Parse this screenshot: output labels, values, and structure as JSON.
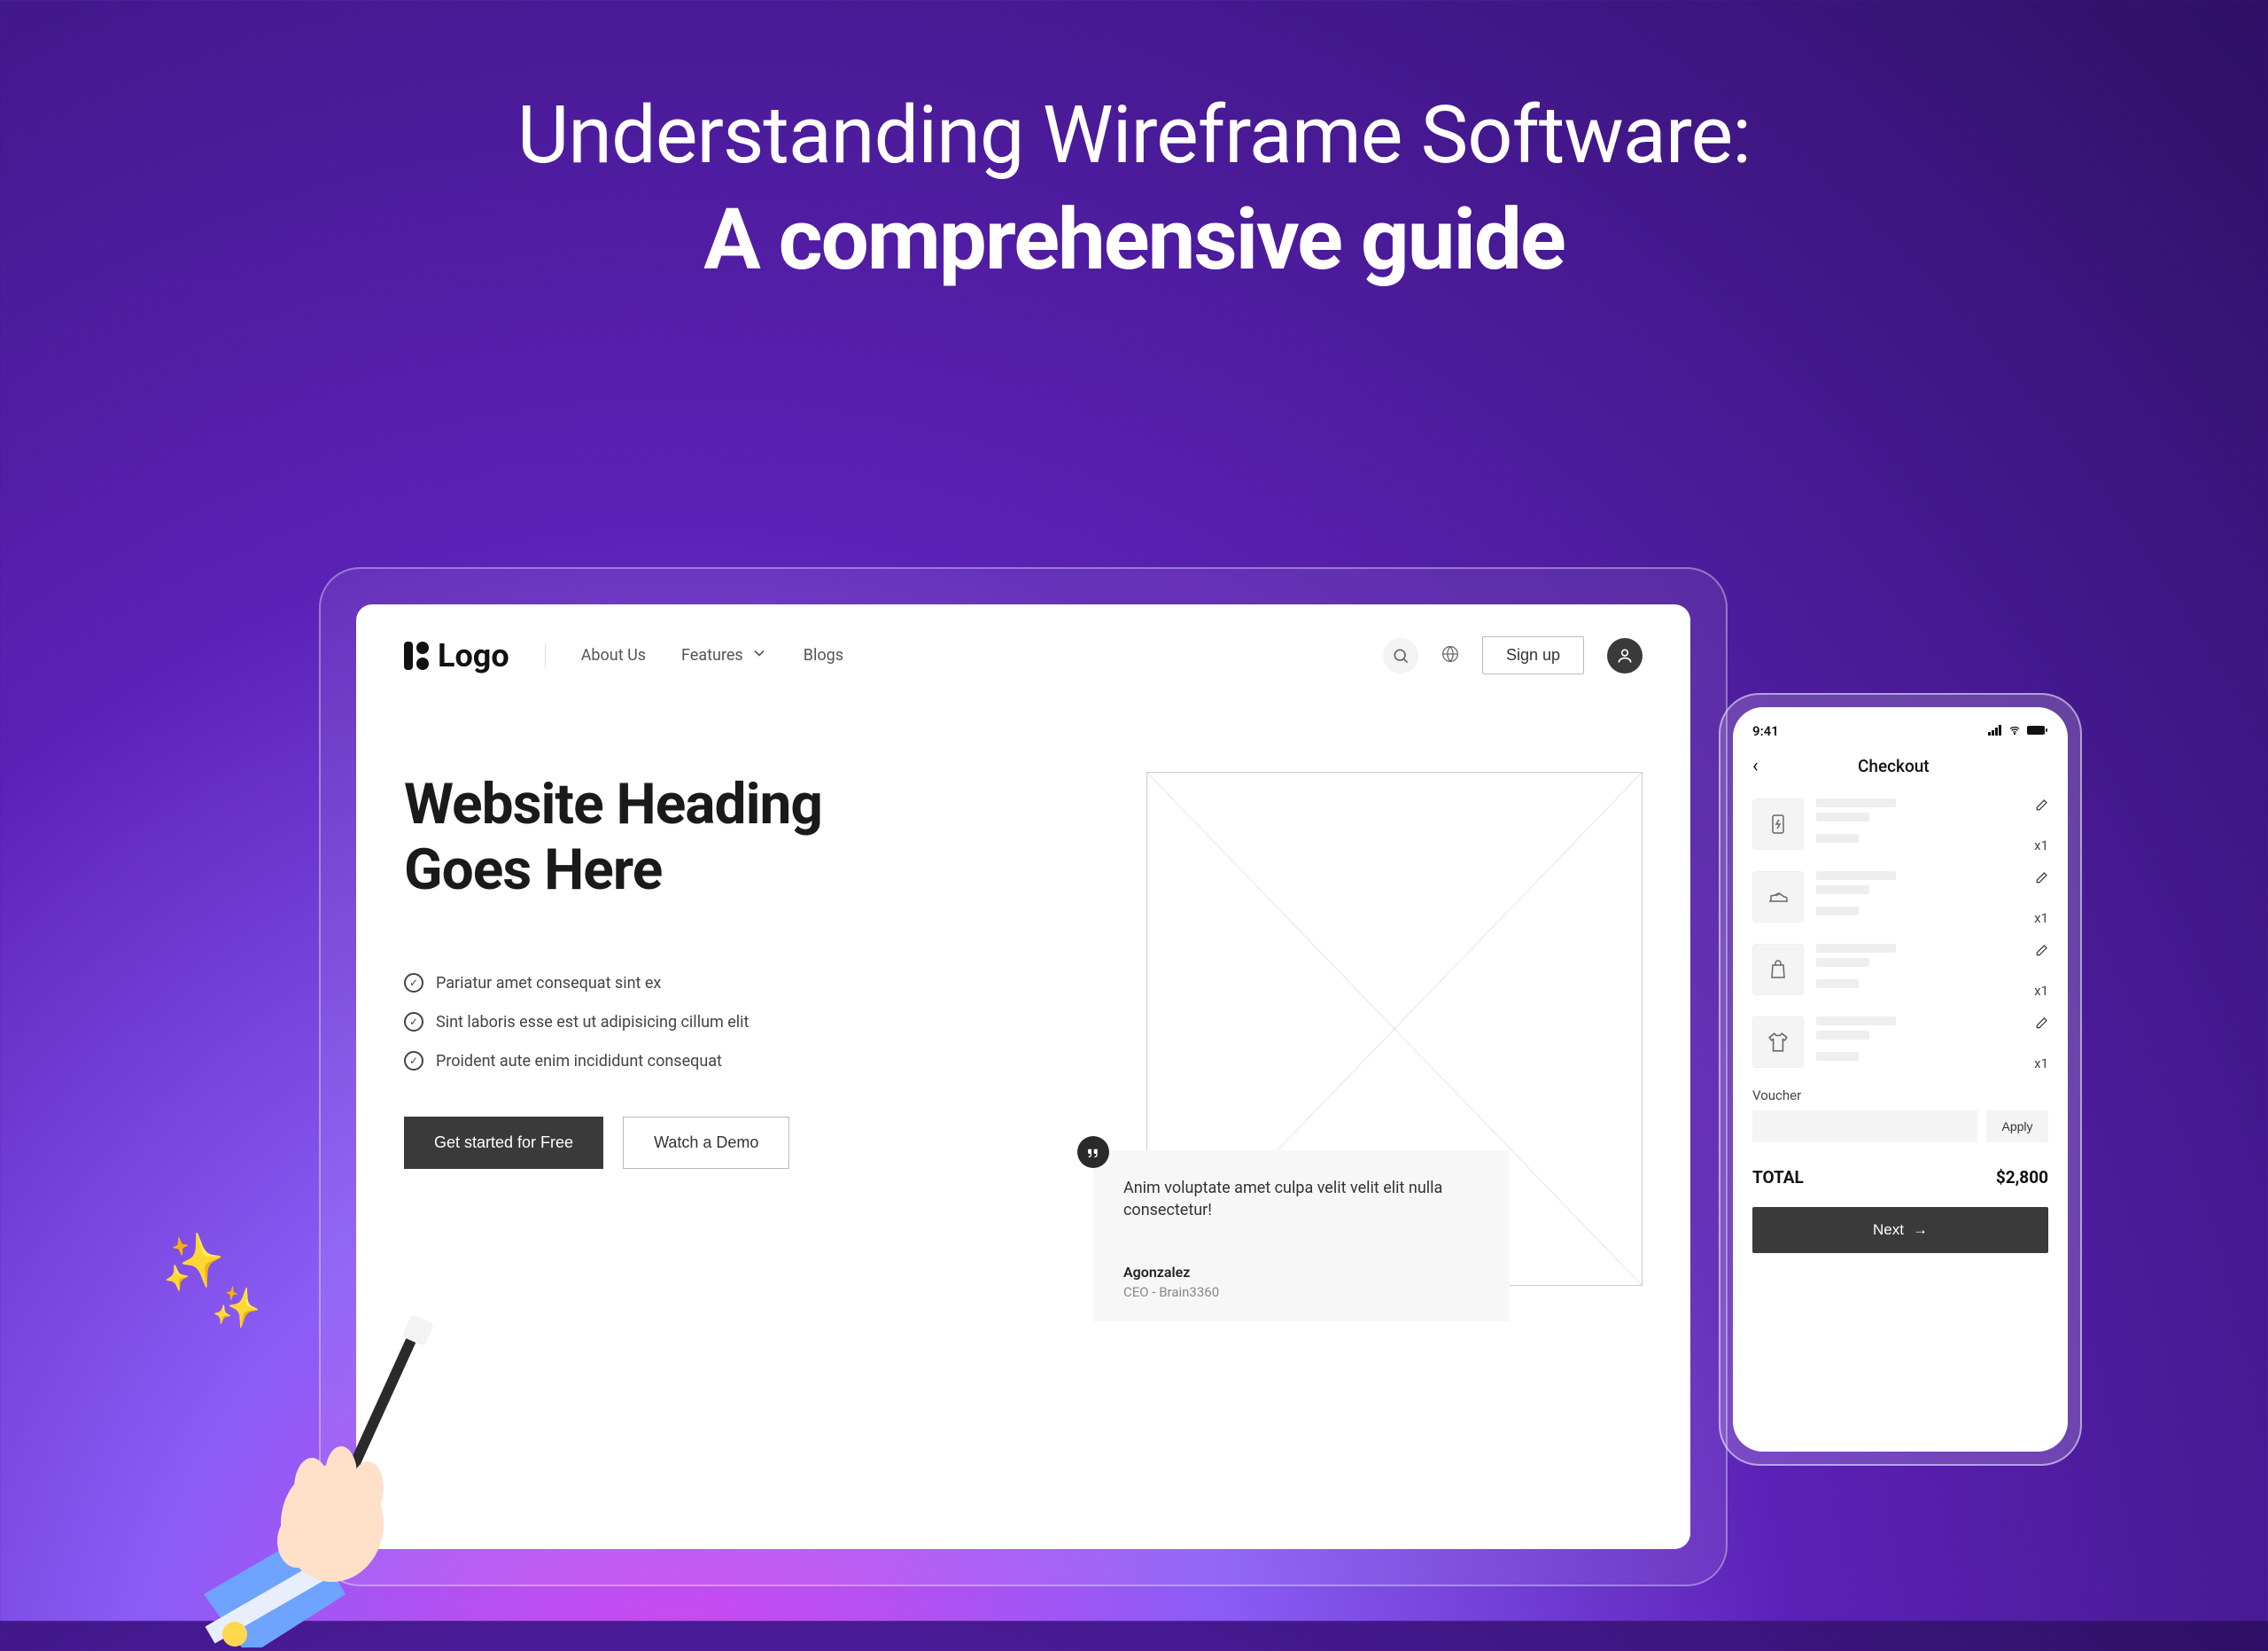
{
  "title": {
    "line1": "Understanding Wireframe Software:",
    "line2": "A comprehensive guide"
  },
  "tablet": {
    "logo": "Logo",
    "nav": {
      "about": "About Us",
      "features": "Features",
      "blogs": "Blogs",
      "signup": "Sign up"
    },
    "hero": {
      "heading_line1": "Website Heading",
      "heading_line2": "Goes Here",
      "bullets": [
        "Pariatur amet consequat sint ex",
        "Sint laboris esse est ut adipisicing cillum elit",
        "Proident aute enim incididunt consequat"
      ],
      "cta_primary": "Get started for Free",
      "cta_secondary": "Watch a Demo"
    },
    "testimonial": {
      "text": "Anim voluptate amet culpa velit velit elit nulla consectetur!",
      "author": "Agonzalez",
      "role": "CEO - Brain3360"
    }
  },
  "phone": {
    "status_time": "9:41",
    "title": "Checkout",
    "items": [
      {
        "icon": "bolt",
        "qty": "x1"
      },
      {
        "icon": "shoe",
        "qty": "x1"
      },
      {
        "icon": "bag",
        "qty": "x1"
      },
      {
        "icon": "shirt",
        "qty": "x1"
      }
    ],
    "voucher_label": "Voucher",
    "voucher_apply": "Apply",
    "total_label": "TOTAL",
    "total_value": "$2,800",
    "next": "Next"
  }
}
